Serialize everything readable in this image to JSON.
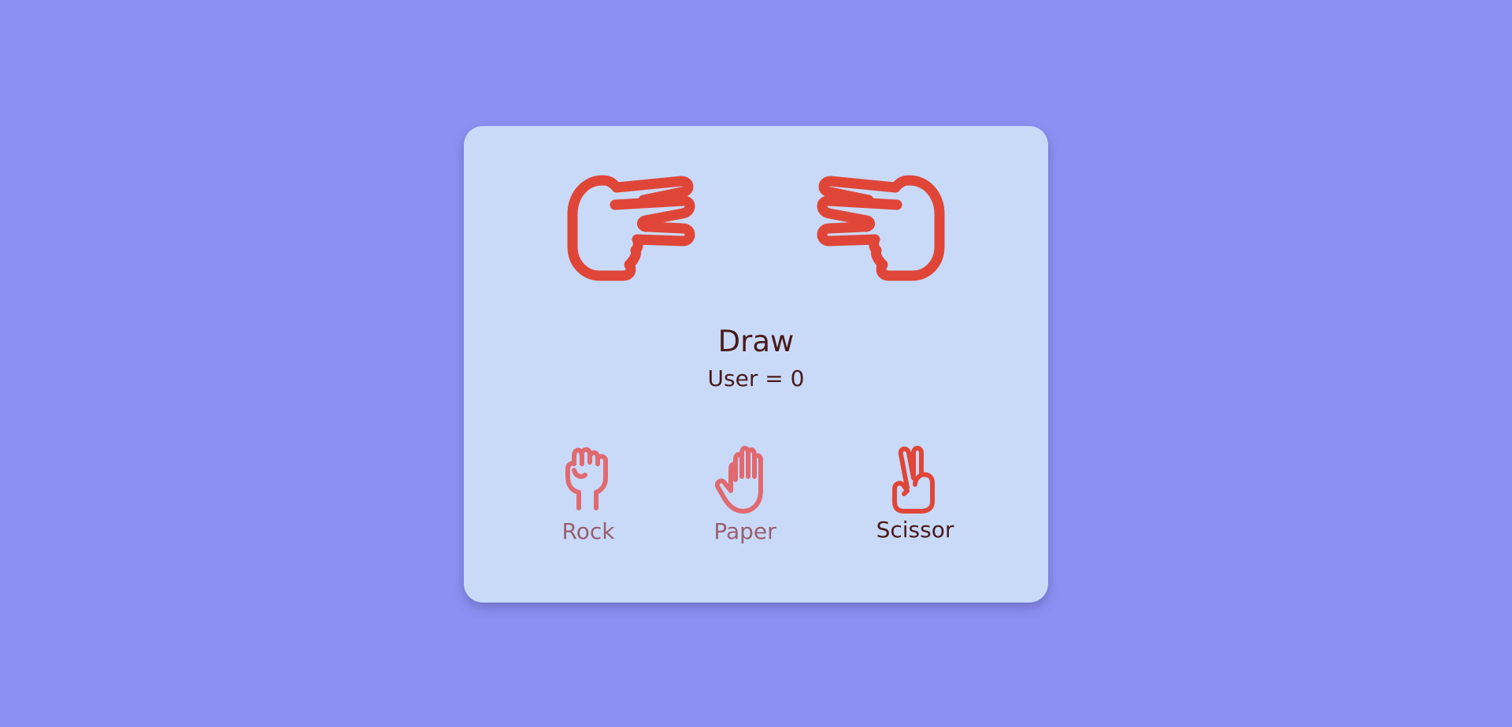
{
  "game": {
    "user_hand_icon": "scissor-hand-icon",
    "computer_hand_icon": "scissor-hand-icon",
    "result": "Draw",
    "score_text": "User = 0"
  },
  "choices": [
    {
      "label": "Rock",
      "icon": "rock-hand-icon",
      "selected": false
    },
    {
      "label": "Paper",
      "icon": "paper-hand-icon",
      "selected": false
    },
    {
      "label": "Scissor",
      "icon": "scissor-hand-icon",
      "selected": true
    }
  ],
  "colors": {
    "background": "#8c90f2",
    "card": "#c9daf9",
    "accent": "#e04638",
    "accent_faded": "#e06a70",
    "text_dark": "#4a1a1a",
    "text_faded": "#9a5f6e"
  }
}
